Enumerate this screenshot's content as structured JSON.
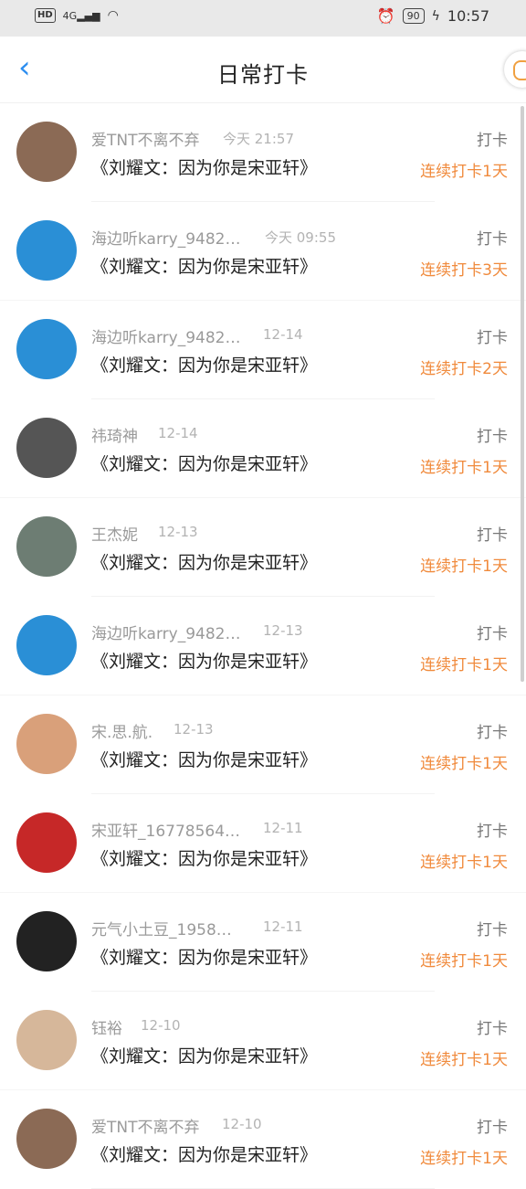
{
  "status": {
    "network": "4G",
    "hd": "HD",
    "battery": "90",
    "time": "10:57"
  },
  "nav": {
    "title": "日常打卡"
  },
  "items": [
    {
      "name": "爱TNT不离不弃",
      "time": "今天 21:57",
      "content": "《刘耀文：因为你是宋亚轩》",
      "type": "打卡",
      "streak": "连续打卡1天",
      "avatar_color": "#8b6a55"
    },
    {
      "name": "海边听karry_9482…",
      "time": "今天 09:55",
      "content": "《刘耀文：因为你是宋亚轩》",
      "type": "打卡",
      "streak": "连续打卡3天",
      "avatar_color": "#2a8fd6"
    },
    {
      "name": "海边听karry_9482…",
      "time": "12-14",
      "content": "《刘耀文：因为你是宋亚轩》",
      "type": "打卡",
      "streak": "连续打卡2天",
      "avatar_color": "#2a8fd6"
    },
    {
      "name": "祎琦神",
      "time": "12-14",
      "content": "《刘耀文：因为你是宋亚轩》",
      "type": "打卡",
      "streak": "连续打卡1天",
      "avatar_color": "#555555"
    },
    {
      "name": "王杰妮",
      "time": "12-13",
      "content": "《刘耀文：因为你是宋亚轩》",
      "type": "打卡",
      "streak": "连续打卡1天",
      "avatar_color": "#6d7d73"
    },
    {
      "name": "海边听karry_9482…",
      "time": "12-13",
      "content": "《刘耀文：因为你是宋亚轩》",
      "type": "打卡",
      "streak": "连续打卡1天",
      "avatar_color": "#2a8fd6"
    },
    {
      "name": "宋.思.航.",
      "time": "12-13",
      "content": "《刘耀文：因为你是宋亚轩》",
      "type": "打卡",
      "streak": "连续打卡1天",
      "avatar_color": "#d9a07a"
    },
    {
      "name": "宋亚轩_16778564…",
      "time": "12-11",
      "content": "《刘耀文：因为你是宋亚轩》",
      "type": "打卡",
      "streak": "连续打卡1天",
      "avatar_color": "#c62828"
    },
    {
      "name": "元气小土豆_1958…",
      "time": "12-11",
      "content": "《刘耀文：因为你是宋亚轩》",
      "type": "打卡",
      "streak": "连续打卡1天",
      "avatar_color": "#222222"
    },
    {
      "name": "钰裕",
      "time": "12-10",
      "content": "《刘耀文：因为你是宋亚轩》",
      "type": "打卡",
      "streak": "连续打卡1天",
      "avatar_color": "#d6b79a"
    },
    {
      "name": "爱TNT不离不弃",
      "time": "12-10",
      "content": "《刘耀文：因为你是宋亚轩》",
      "type": "打卡",
      "streak": "连续打卡1天",
      "avatar_color": "#8b6a55"
    }
  ]
}
